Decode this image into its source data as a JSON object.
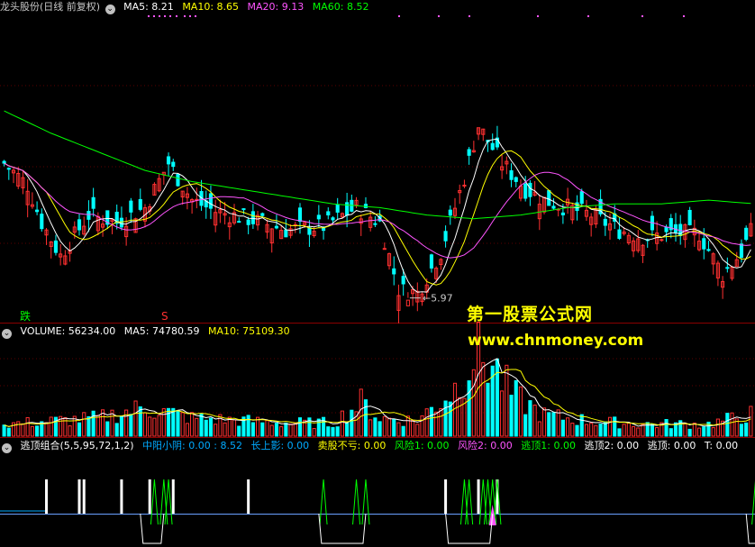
{
  "price_panel": {
    "title": "龙头股份(日线 前复权)",
    "ma": [
      {
        "label": "MA5: 8.21",
        "color": "#ffffff"
      },
      {
        "label": "MA10: 8.65",
        "color": "#ffff00"
      },
      {
        "label": "MA20: 9.13",
        "color": "#ff55ff"
      },
      {
        "label": "MA60: 8.52",
        "color": "#00ff00"
      }
    ],
    "low_marker": "5.97",
    "signal_die": "跌",
    "signal_s": "S"
  },
  "volume_panel": {
    "labels": [
      {
        "label": "VOLUME: 56234.00",
        "color": "#ffffff"
      },
      {
        "label": "MA5: 74780.59",
        "color": "#ffffff"
      },
      {
        "label": "MA10: 75109.30",
        "color": "#ffff00"
      }
    ]
  },
  "indicator_panel": {
    "labels": [
      {
        "label": "逃顶组合(5,5,95,72,1,2)",
        "color": "#ffffff"
      },
      {
        "label": "中阳小阴: 0.00 : 8.52",
        "color": "#00aaff"
      },
      {
        "label": "长上影: 0.00",
        "color": "#00aaff"
      },
      {
        "label": "卖股不亏: 0.00",
        "color": "#ffff00"
      },
      {
        "label": "风险1: 0.00",
        "color": "#00ff00"
      },
      {
        "label": "风险2: 0.00",
        "color": "#ff55ff"
      },
      {
        "label": "逃顶1: 0.00",
        "color": "#00ff00"
      },
      {
        "label": "逃顶2: 0.00",
        "color": "#ffffff"
      },
      {
        "label": "逃顶: 0.00",
        "color": "#ffffff"
      },
      {
        "label": "T: 0.00",
        "color": "#ffffff"
      }
    ]
  },
  "watermark": {
    "line1": "第一股票公式网",
    "line2": "www.chnmoney.com"
  },
  "chart_data": [
    {
      "type": "candlestick",
      "title": "龙头股份(日线 前复权)",
      "n_bars": 160,
      "ylim": [
        5.5,
        13.5
      ],
      "colors": {
        "up": "#ff3030",
        "down": "#00ffff",
        "MA5": "#ffffff",
        "MA10": "#ffff00",
        "MA20": "#ff55ff",
        "MA60": "#00ff00"
      },
      "close_anchors": [
        [
          0,
          9.6
        ],
        [
          5,
          9.0
        ],
        [
          8,
          8.0
        ],
        [
          12,
          7.1
        ],
        [
          18,
          8.2
        ],
        [
          24,
          8.0
        ],
        [
          30,
          8.4
        ],
        [
          35,
          9.6
        ],
        [
          40,
          8.6
        ],
        [
          45,
          8.3
        ],
        [
          52,
          8.1
        ],
        [
          60,
          7.8
        ],
        [
          68,
          7.9
        ],
        [
          75,
          8.4
        ],
        [
          80,
          8.0
        ],
        [
          84,
          6.2
        ],
        [
          88,
          6.1
        ],
        [
          93,
          7.2
        ],
        [
          98,
          9.2
        ],
        [
          101,
          10.6
        ],
        [
          106,
          9.6
        ],
        [
          111,
          8.9
        ],
        [
          115,
          8.6
        ],
        [
          120,
          8.4
        ],
        [
          125,
          8.2
        ],
        [
          131,
          7.8
        ],
        [
          136,
          7.6
        ],
        [
          142,
          7.7
        ],
        [
          148,
          7.7
        ],
        [
          153,
          6.6
        ],
        [
          157,
          7.2
        ],
        [
          160,
          8.0
        ],
        [
          166,
          8.9
        ],
        [
          168,
          8.2
        ]
      ],
      "ma60_anchors": [
        [
          0,
          11.0
        ],
        [
          10,
          10.4
        ],
        [
          20,
          9.9
        ],
        [
          30,
          9.4
        ],
        [
          40,
          9.1
        ],
        [
          50,
          8.9
        ],
        [
          60,
          8.7
        ],
        [
          70,
          8.5
        ],
        [
          80,
          8.4
        ],
        [
          90,
          8.2
        ],
        [
          100,
          8.1
        ],
        [
          110,
          8.2
        ],
        [
          120,
          8.4
        ],
        [
          130,
          8.5
        ],
        [
          140,
          8.5
        ],
        [
          150,
          8.6
        ],
        [
          160,
          8.5
        ],
        [
          168,
          8.5
        ]
      ],
      "low_point": {
        "index": 86,
        "value": 5.97
      }
    },
    {
      "type": "bar",
      "title": "VOLUME",
      "ylim": [
        0,
        160000
      ],
      "series": [
        {
          "name": "VOLUME",
          "last": 56234.0
        },
        {
          "name": "MA5",
          "last": 74780.59
        },
        {
          "name": "MA10",
          "last": 75109.3
        }
      ],
      "volume_anchors": [
        [
          0,
          20000
        ],
        [
          20,
          30000
        ],
        [
          30,
          48000
        ],
        [
          40,
          30000
        ],
        [
          60,
          22000
        ],
        [
          70,
          22000
        ],
        [
          76,
          56000
        ],
        [
          80,
          30000
        ],
        [
          88,
          26000
        ],
        [
          96,
          80000
        ],
        [
          100,
          140000
        ],
        [
          104,
          120000
        ],
        [
          108,
          70000
        ],
        [
          115,
          35000
        ],
        [
          125,
          25000
        ],
        [
          135,
          20000
        ],
        [
          150,
          20000
        ],
        [
          160,
          38000
        ],
        [
          168,
          56000
        ]
      ]
    },
    {
      "type": "signal",
      "title": "逃顶组合(5,5,95,72,1,2)",
      "baseline": 8.52,
      "white_signal_bars": [
        9,
        16,
        17,
        25,
        31,
        36,
        52,
        94,
        101,
        105,
        165
      ],
      "green_spikes": [
        32,
        34,
        35,
        68,
        75,
        77,
        98,
        99,
        102,
        103,
        104,
        105,
        160,
        162,
        165,
        167
      ],
      "magenta_spikes": [
        104
      ],
      "blue_step_until": 9,
      "purple_dips": [
        [
          29,
          34
        ],
        [
          67,
          77
        ],
        [
          94,
          104
        ],
        [
          158,
          166
        ]
      ]
    }
  ]
}
